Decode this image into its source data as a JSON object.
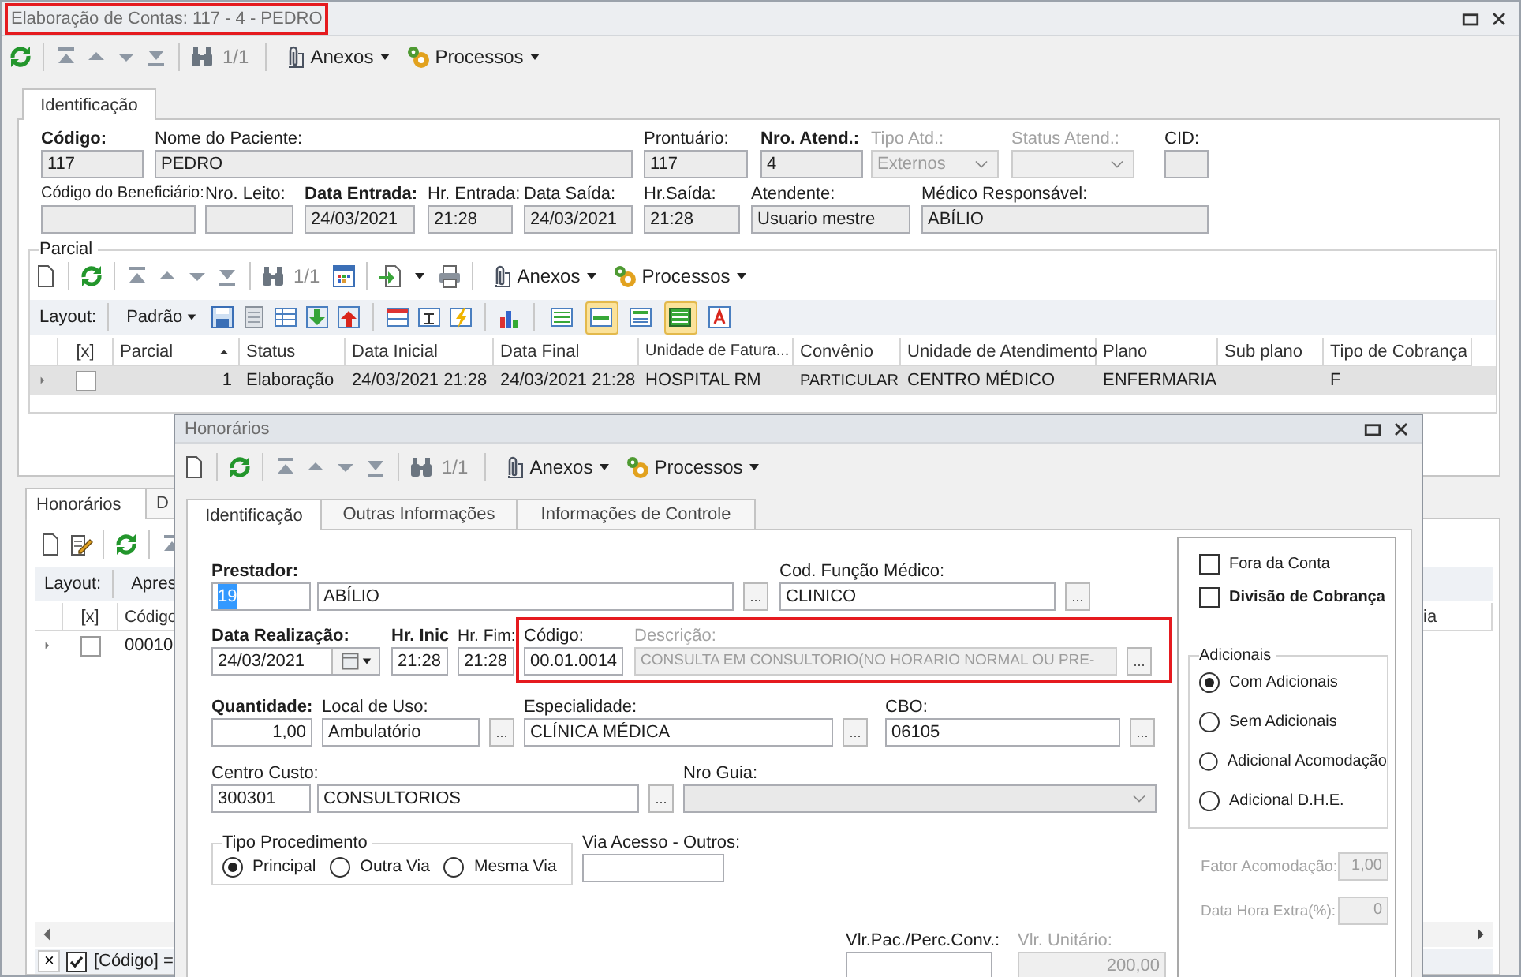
{
  "main_window": {
    "title": "Elaboração de Contas: 117 - 4 - PEDRO",
    "title_highlighted": true,
    "toolbar": {
      "record_counter": "1/1",
      "menus": [
        "Anexos",
        "Processos"
      ]
    },
    "tabs": [
      {
        "label": "Identificação",
        "selected": true
      }
    ],
    "form": {
      "fields": [
        {
          "label": "Código:",
          "bold": true,
          "disabled": false,
          "kind": "text",
          "inputs": [
            "117"
          ]
        },
        {
          "label": "Nome do Paciente:",
          "bold": false,
          "disabled": false,
          "kind": "text",
          "inputs": [
            "PEDRO"
          ]
        },
        {
          "label": "Prontuário:",
          "bold": false,
          "disabled": false,
          "kind": "text",
          "inputs": [
            "117"
          ]
        },
        {
          "label": "Nro. Atend.:",
          "bold": true,
          "disabled": false,
          "kind": "text",
          "inputs": [
            "4"
          ]
        },
        {
          "label": "Tipo Atd.:",
          "bold": false,
          "disabled": true,
          "kind": "dropdown",
          "inputs": [
            "Externos"
          ]
        },
        {
          "label": "Status Atend.:",
          "bold": false,
          "disabled": true,
          "kind": "dropdown"
        },
        {
          "label": "CID:",
          "bold": false,
          "disabled": false,
          "kind": "text"
        },
        {
          "label": "Código do Beneficiário:",
          "bold": false,
          "disabled": false,
          "kind": "text"
        },
        {
          "label": "Nro. Leito:",
          "bold": false,
          "disabled": false,
          "kind": "text"
        },
        {
          "label": "Data Entrada:",
          "bold": true,
          "disabled": false,
          "kind": "text",
          "inputs": [
            "24/03/2021"
          ]
        },
        {
          "label": "Hr. Entrada:",
          "bold": false,
          "disabled": false,
          "kind": "text",
          "inputs": [
            "21:28"
          ]
        },
        {
          "label": "Data Saída:",
          "bold": false,
          "disabled": false,
          "kind": "text",
          "inputs": [
            "24/03/2021"
          ]
        },
        {
          "label": "Hr.Saída:",
          "bold": false,
          "disabled": false,
          "kind": "text",
          "inputs": [
            "21:28"
          ]
        },
        {
          "label": "Atendente:",
          "bold": false,
          "disabled": false,
          "kind": "text",
          "inputs": [
            "Usuario mestre"
          ]
        },
        {
          "label": "Médico Responsável:",
          "bold": false,
          "disabled": false,
          "kind": "text",
          "inputs": [
            "ABÍLIO"
          ]
        }
      ]
    },
    "parcial": {
      "title": "Parcial",
      "toolbar": {
        "record_counter": "1/1",
        "menus": [
          "Anexos",
          "Processos"
        ]
      },
      "layout_bar": {
        "label": "Layout:",
        "layout": "Padrão",
        "view_toggles": [
          {
            "on": false
          },
          {
            "on": true
          },
          {
            "on": false
          },
          {
            "on": true
          },
          {
            "on": false
          }
        ]
      },
      "table": {
        "checkbox_column": "[x]",
        "columns": [
          {
            "label": "Parcial",
            "sorted": true
          },
          {
            "label": "Status",
            "sorted": false
          },
          {
            "label": "Data Inicial",
            "sorted": false
          },
          {
            "label": "Data Final",
            "sorted": false
          },
          {
            "label": "Unidade de Fatura...",
            "sorted": false
          },
          {
            "label": "Convênio",
            "sorted": false
          },
          {
            "label": "Unidade de Atendimento",
            "sorted": false
          },
          {
            "label": "Plano",
            "sorted": false
          },
          {
            "label": "Sub plano",
            "sorted": false
          },
          {
            "label": "Tipo de Cobrança",
            "sorted": false
          }
        ],
        "rows": [
          {
            "selected": true,
            "checked": false,
            "cells": [
              "1",
              "Elaboração",
              "24/03/2021 21:28",
              "24/03/2021 21:28",
              "HOSPITAL RM",
              "PARTICULAR",
              "CENTRO MÉDICO",
              "ENFERMARIA",
              "",
              "F"
            ]
          }
        ]
      }
    },
    "lower_panel": {
      "tabs": [
        {
          "label": "Honorários",
          "selected": true
        },
        {
          "label": "D",
          "selected": false
        }
      ],
      "layout_bar": {
        "label": "Layout:",
        "layout": "Apres"
      },
      "table": {
        "checkbox_column": "[x]",
        "columns": [
          {
            "label": "Código",
            "sorted": false
          },
          {
            "label": "ia",
            "sorted": false
          }
        ],
        "rows": [
          {
            "selected": false,
            "checked": false,
            "cells": [
              "00010",
              ""
            ]
          }
        ]
      },
      "filter": {
        "clear": "×",
        "enabled": true,
        "text": "[Código] ="
      }
    }
  },
  "dialog": {
    "title": "Honorários",
    "toolbar": {
      "record_counter": "1/1",
      "menus": [
        "Anexos",
        "Processos"
      ]
    },
    "tabs": [
      {
        "label": "Identificação",
        "selected": true
      },
      {
        "label": "Outras Informações",
        "selected": false
      },
      {
        "label": "Informações de Controle",
        "selected": false
      }
    ],
    "fields": [
      {
        "label": "Prestador:",
        "bold": true,
        "disabled": false,
        "kind": "text",
        "inputs": [
          "19",
          "ABÍLIO"
        ],
        "text_selected": true,
        "button": "...",
        "highlighted": false
      },
      {
        "label": "Cod. Função Médico:",
        "bold": false,
        "disabled": false,
        "kind": "text",
        "inputs": [
          "CLINICO"
        ],
        "text_selected": false,
        "button": "...",
        "highlighted": false
      },
      {
        "label": "Data Realização:",
        "bold": true,
        "disabled": false,
        "kind": "date",
        "inputs": [
          "24/03/2021"
        ],
        "highlighted": false
      },
      {
        "label": "Hr. Inic",
        "bold": true,
        "disabled": false,
        "kind": "text",
        "inputs": [
          "21:28"
        ],
        "highlighted": false
      },
      {
        "label": "Hr. Fim:",
        "bold": false,
        "disabled": false,
        "kind": "text",
        "inputs": [
          "21:28"
        ],
        "highlighted": false
      },
      {
        "label": "Código:",
        "bold": false,
        "disabled": false,
        "kind": "text",
        "inputs": [
          "00.01.0014"
        ],
        "highlighted": true
      },
      {
        "label": "Descrição:",
        "bold": false,
        "disabled": true,
        "kind": "text",
        "inputs": [
          "CONSULTA EM CONSULTORIO(NO HORARIO NORMAL OU PRE-"
        ],
        "button": "...",
        "highlighted": true
      },
      {
        "label": "Quantidade:",
        "bold": true,
        "disabled": false,
        "kind": "number",
        "inputs": [
          "1,00"
        ],
        "highlighted": false
      },
      {
        "label": "Local de Uso:",
        "bold": false,
        "disabled": false,
        "kind": "text",
        "inputs": [
          "Ambulatório"
        ],
        "button": "...",
        "highlighted": false
      },
      {
        "label": "Especialidade:",
        "bold": false,
        "disabled": false,
        "kind": "text",
        "inputs": [
          "CLÍNICA MÉDICA"
        ],
        "button": "...",
        "highlighted": false
      },
      {
        "label": "CBO:",
        "bold": false,
        "disabled": false,
        "kind": "text",
        "inputs": [
          "06105"
        ],
        "button": "...",
        "highlighted": false
      },
      {
        "label": "Centro Custo:",
        "bold": false,
        "disabled": false,
        "kind": "text",
        "inputs": [
          "300301",
          "CONSULTORIOS"
        ],
        "button": "...",
        "highlighted": false
      },
      {
        "label": "Nro Guia:",
        "bold": false,
        "disabled": false,
        "kind": "dropdown",
        "highlighted": false
      }
    ],
    "tipo_procedimento": {
      "title": "Tipo Procedimento",
      "options": [
        {
          "label": "Principal",
          "selected": true
        },
        {
          "label": "Outra Via",
          "selected": false
        },
        {
          "label": "Mesma Via",
          "selected": false
        }
      ]
    },
    "via_acesso": {
      "label": "Via Acesso - Outros:",
      "bold": false,
      "disabled": false,
      "kind": "text"
    },
    "values": [
      {
        "label": "Vlr.Pac./Perc.Conv.:",
        "bold": false,
        "disabled": false,
        "kind": "number"
      },
      {
        "label": "Vlr. Unitário:",
        "bold": false,
        "disabled": true,
        "kind": "number",
        "inputs": [
          "200,00"
        ]
      }
    ],
    "side": {
      "checkboxes": [
        {
          "label": "Fora da Conta",
          "checked": false,
          "bold": false
        },
        {
          "label": "Divisão de Cobrança",
          "checked": false,
          "bold": true
        }
      ],
      "adicionais": {
        "title": "Adicionais",
        "options": [
          {
            "label": "Com Adicionais",
            "selected": true
          },
          {
            "label": "Sem Adicionais",
            "selected": false
          },
          {
            "label": "Adicional Acomodação",
            "selected": false
          },
          {
            "label": "Adicional D.H.E.",
            "selected": false
          }
        ]
      },
      "factors": [
        {
          "label": "Fator Acomodação:",
          "value": "1,00",
          "disabled": true
        },
        {
          "label": "Data Hora Extra(%):",
          "value": "0",
          "disabled": true
        }
      ]
    }
  }
}
